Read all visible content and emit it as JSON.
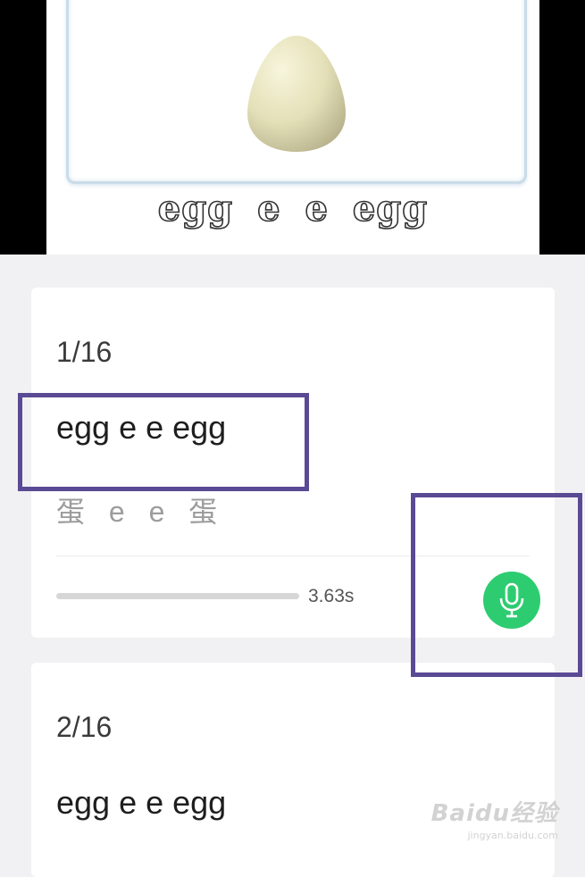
{
  "video": {
    "caption": "egg e e egg",
    "image_icon": "egg"
  },
  "cards": [
    {
      "counter": "1/16",
      "sentence": "egg e e egg",
      "translation": "蛋 e e 蛋",
      "duration": "3.63s",
      "progress": 0,
      "mic_icon": "microphone-icon"
    },
    {
      "counter": "2/16",
      "sentence": "egg e e egg"
    }
  ],
  "watermark": {
    "logo": "Baidu经验",
    "url": "jingyan.baidu.com"
  },
  "colors": {
    "accent_green": "#2ecc71",
    "highlight_purple": "#5a4a94",
    "background": "#f1f1f3"
  }
}
